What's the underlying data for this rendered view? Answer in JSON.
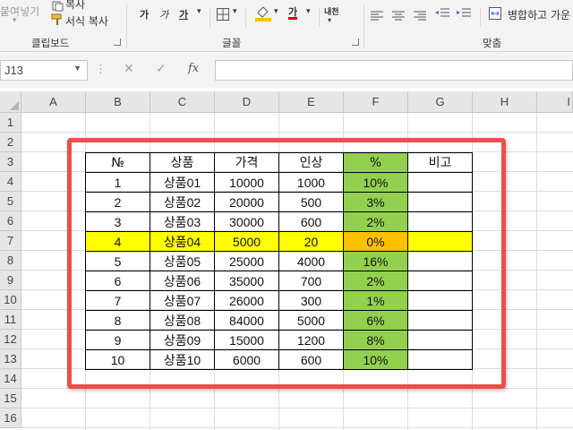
{
  "ribbon": {
    "paste_format_label": "붙여넣기",
    "copy_label": "복사",
    "format_painter_label": "서식 복사",
    "bold_label": "가",
    "italic_label": "가",
    "underline_label": "가",
    "font_color_glyph": "가",
    "phonetic_label": "내천",
    "merge_center_label": "병합하고 가운",
    "groups": {
      "clipboard": "클립보드",
      "font": "글꼴",
      "alignment": "맞춤"
    },
    "colors": {
      "fill": "#ffc000",
      "font_color": "#e00000"
    }
  },
  "formula_bar": {
    "name_box": "J13",
    "cancel_glyph": "✕",
    "enter_glyph": "✓",
    "fx_label": "fx",
    "formula": ""
  },
  "columns": [
    "A",
    "B",
    "C",
    "D",
    "E",
    "F",
    "G",
    "H",
    "I"
  ],
  "rows": [
    "1",
    "2",
    "3",
    "4",
    "5",
    "6",
    "7",
    "8",
    "9",
    "10",
    "11",
    "12",
    "13",
    "14",
    "15",
    "16"
  ],
  "table": {
    "headers": [
      "№",
      "상품",
      "가격",
      "인상",
      "%",
      "비고"
    ],
    "rows": [
      [
        "1",
        "상품01",
        "10000",
        "1000",
        "10%",
        ""
      ],
      [
        "2",
        "상품02",
        "20000",
        "500",
        "3%",
        ""
      ],
      [
        "3",
        "상품03",
        "30000",
        "600",
        "2%",
        ""
      ],
      [
        "4",
        "상품04",
        "5000",
        "20",
        "0%",
        ""
      ],
      [
        "5",
        "상품05",
        "25000",
        "4000",
        "16%",
        ""
      ],
      [
        "6",
        "상품06",
        "35000",
        "700",
        "2%",
        ""
      ],
      [
        "7",
        "상품07",
        "26000",
        "300",
        "1%",
        ""
      ],
      [
        "8",
        "상품08",
        "84000",
        "5000",
        "6%",
        ""
      ],
      [
        "9",
        "상품09",
        "15000",
        "1200",
        "8%",
        ""
      ],
      [
        "10",
        "상품10",
        "6000",
        "600",
        "10%",
        ""
      ]
    ],
    "highlight_row_index": 3,
    "colors": {
      "highlight_row": "#ffff00",
      "percent_cell": "#92d050",
      "percent_highlight": "#ffc000",
      "annotation_box": "#f24b4b"
    }
  }
}
